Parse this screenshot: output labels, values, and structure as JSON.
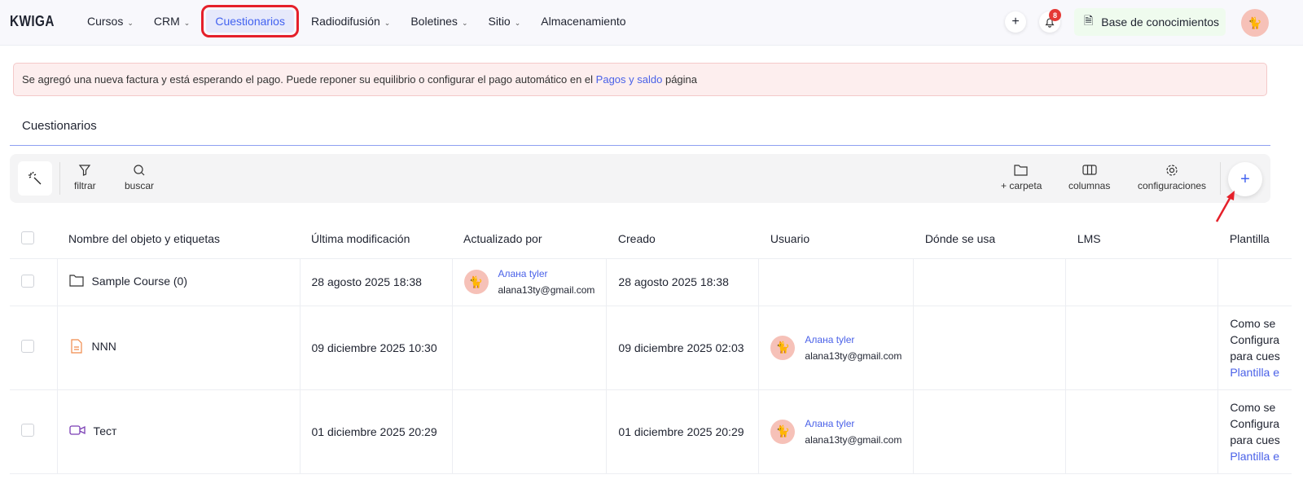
{
  "header": {
    "logo": "KWIGA",
    "nav": [
      {
        "label": "Cursos",
        "dropdown": true
      },
      {
        "label": "CRM",
        "dropdown": true
      },
      {
        "label": "Cuestionarios",
        "active": true
      },
      {
        "label": "Radiodifusión",
        "dropdown": true
      },
      {
        "label": "Boletines",
        "dropdown": true
      },
      {
        "label": "Sitio",
        "dropdown": true
      },
      {
        "label": "Almacenamiento"
      }
    ],
    "notifications_count": "8",
    "knowledge_base": "Base de conocimientos"
  },
  "alert": {
    "text": "Se agregó una nueva factura y está esperando el pago. Puede reponer su equilibrio o configurar el pago automático en el",
    "link": "Pagos y saldo",
    "suffix": "página"
  },
  "page": {
    "title": "Cuestionarios"
  },
  "toolbar": {
    "filter": "filtrar",
    "search": "buscar",
    "folder": "+ carpeta",
    "columns": "columnas",
    "settings": "configuraciones"
  },
  "table": {
    "headers": [
      "Nombre del objeto y etiquetas",
      "Última modificación",
      "Actualizado por",
      "Creado",
      "Usuario",
      "Dónde se usa",
      "LMS",
      "Plantilla"
    ],
    "rows": [
      {
        "type": "folder",
        "name": "Sample Course (0)",
        "modified": "28 agosto 2025 18:38",
        "updated_by": {
          "name": "Алана tyler",
          "email": "alana13ty@gmail.com"
        },
        "created": "28 agosto 2025 18:38"
      },
      {
        "type": "document",
        "name": "NNN",
        "modified": "09 diciembre 2025 10:30",
        "created": "09 diciembre 2025 02:03",
        "user": {
          "name": "Алана tyler",
          "email": "alana13ty@gmail.com"
        },
        "template": [
          "Como se",
          "Configura",
          "para cues",
          "Plantilla e"
        ]
      },
      {
        "type": "video",
        "name": "Тест",
        "modified": "01 diciembre 2025 20:29",
        "created": "01 diciembre 2025 20:29",
        "user": {
          "name": "Алана tyler",
          "email": "alana13ty@gmail.com"
        },
        "template": [
          "Como se",
          "Configura",
          "para cues",
          "Plantilla e"
        ]
      }
    ]
  }
}
